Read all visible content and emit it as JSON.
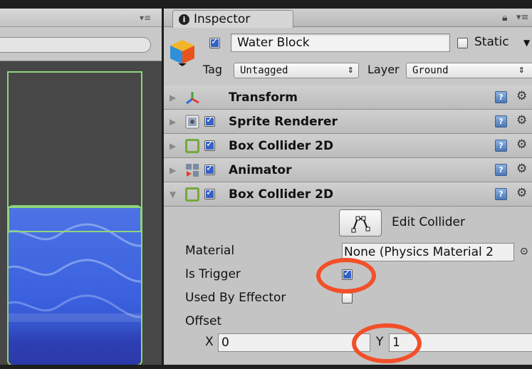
{
  "scene": {
    "menu_icon": "panel-menu-icon"
  },
  "inspector": {
    "tab_label": "Inspector",
    "info_glyph": "i",
    "object_name": "Water Block",
    "object_active": true,
    "static_label": "Static",
    "static_checked": false,
    "tag_label": "Tag",
    "tag_value": "Untagged",
    "layer_label": "Layer",
    "layer_value": "Ground",
    "help_glyph": "?",
    "components": [
      {
        "label": "Transform",
        "icon": "transform-axes-icon",
        "has_checkbox": false,
        "expanded": false
      },
      {
        "label": "Sprite Renderer",
        "icon": "sprite-renderer-icon",
        "has_checkbox": true,
        "enabled": true,
        "expanded": false
      },
      {
        "label": "Box Collider 2D",
        "icon": "box-collider-icon",
        "has_checkbox": true,
        "enabled": true,
        "expanded": false
      },
      {
        "label": "Animator",
        "icon": "animator-icon",
        "has_checkbox": true,
        "enabled": true,
        "expanded": false
      },
      {
        "label": "Box Collider 2D",
        "icon": "box-collider-icon",
        "has_checkbox": true,
        "enabled": true,
        "expanded": true
      }
    ],
    "box_collider": {
      "edit_collider_label": "Edit Collider",
      "material_label": "Material",
      "material_value": "None (Physics Material 2",
      "is_trigger_label": "Is Trigger",
      "is_trigger": true,
      "used_by_effector_label": "Used By Effector",
      "used_by_effector": false,
      "offset_label": "Offset",
      "offset_x_label": "X",
      "offset_x": "0",
      "offset_y_label": "Y",
      "offset_y": "1"
    }
  },
  "colors": {
    "highlight_ring": "#f2502a",
    "checkbox_accent": "#3560c8",
    "collider_outline": "#8fd47a",
    "water": "#3a60df"
  }
}
